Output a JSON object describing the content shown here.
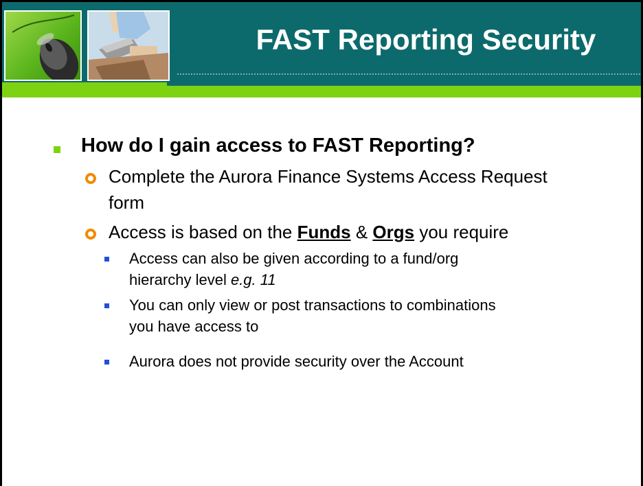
{
  "slide": {
    "title": "FAST Reporting Security",
    "heading": "How do I gain access to FAST Reporting?",
    "bullets": [
      {
        "text_line1": "Complete the Aurora Finance Systems Access Request",
        "text_line2": "form"
      },
      {
        "prefix": "Access is based on the ",
        "funds": "Funds",
        "amp": " & ",
        "orgs": "Orgs",
        "suffix": " you require"
      }
    ],
    "sub_bullets": [
      {
        "line1": "Access can also be given according to a fund/org",
        "line2_prefix": "hierarchy level ",
        "line2_italic": "e.g. 11"
      },
      {
        "line1": "You can only view or post transactions to combinations",
        "line2": "you have access to"
      },
      {
        "line1": "Aurora does not provide security over the Account"
      }
    ]
  },
  "colors": {
    "header_teal": "#0d6a6c",
    "accent_green": "#7dd312",
    "bullet_orange": "#f28a00",
    "bullet_blue": "#2050d8"
  },
  "icons": [
    "computer-mouse-photo",
    "laptop-user-photo"
  ]
}
